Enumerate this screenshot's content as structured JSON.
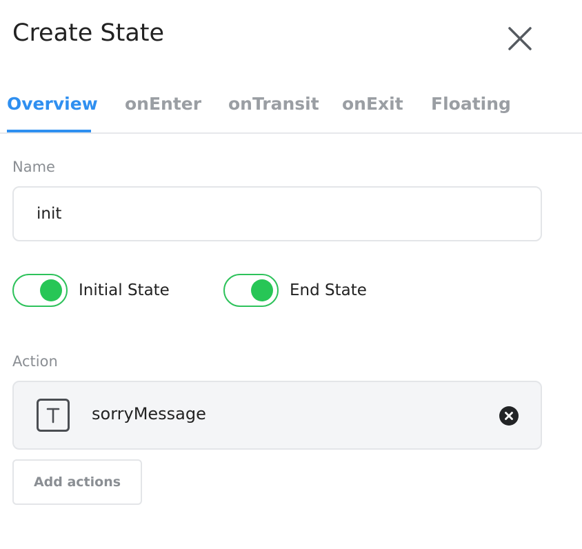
{
  "dialog": {
    "title": "Create State",
    "close_icon": "close-icon"
  },
  "tabs": [
    {
      "label": "Overview",
      "active": true
    },
    {
      "label": "onEnter",
      "active": false
    },
    {
      "label": "onTransit",
      "active": false
    },
    {
      "label": "onExit",
      "active": false
    },
    {
      "label": "Floating",
      "active": false
    }
  ],
  "name_field": {
    "label": "Name",
    "value": "init"
  },
  "toggles": [
    {
      "label": "Initial State",
      "on": true
    },
    {
      "label": "End State",
      "on": true
    }
  ],
  "actions": {
    "label": "Action",
    "items": [
      {
        "name": "sorryMessage",
        "type_icon": "text-type-icon",
        "remove_icon": "remove-circle-icon"
      }
    ],
    "add_label": "Add actions"
  },
  "colors": {
    "accent": "#2f8ff0",
    "toggle_on": "#27c656",
    "muted_text": "#8a8e93"
  }
}
